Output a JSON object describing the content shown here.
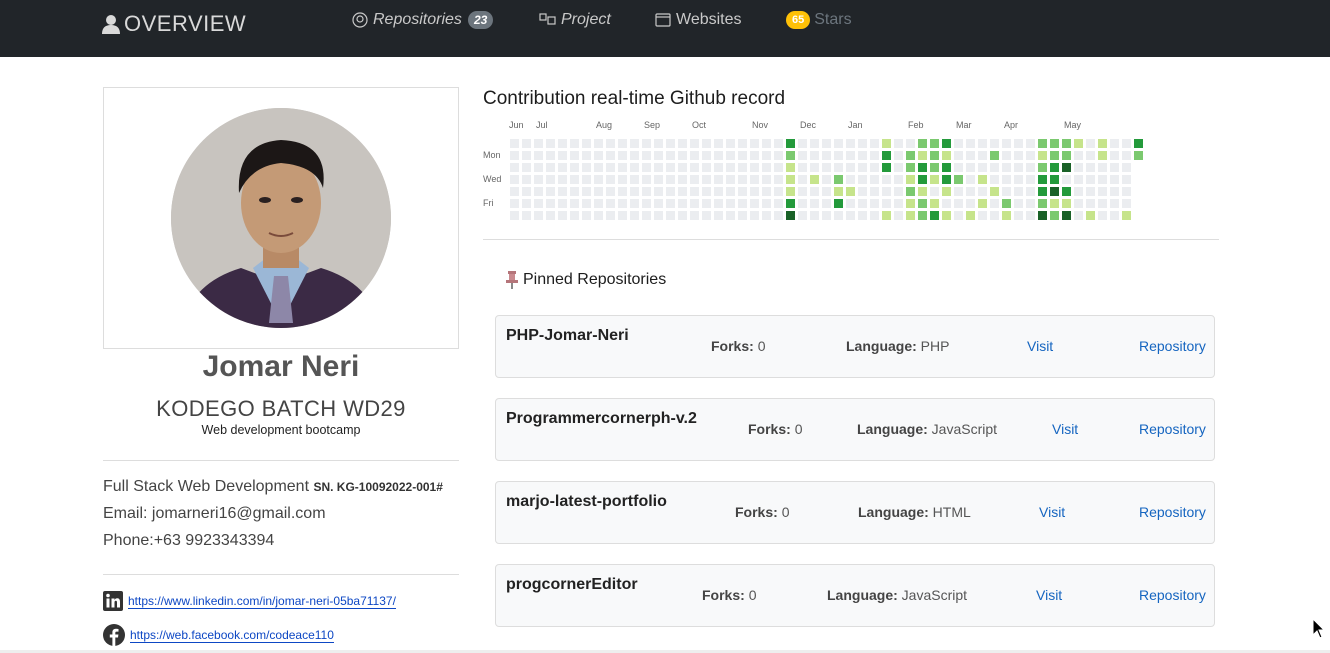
{
  "nav": {
    "brand": "OVERVIEW",
    "repositories_label": "Repositories",
    "repositories_count": "23",
    "project_label": "Project",
    "websites_label": "Websites",
    "stars_count": "65",
    "stars_label": "Stars"
  },
  "profile": {
    "name": "Jomar Neri",
    "batch": "KODEGO BATCH WD29",
    "bootcamp": "Web development bootcamp",
    "role": "Full Stack Web Development",
    "serial": "SN. KG-10092022-001#",
    "email": "Email: jomarneri16@gmail.com",
    "phone": "Phone:+63 9923343394",
    "linkedin": "https://www.linkedin.com/in/jomar-neri-05ba71137/",
    "facebook": "https://web.facebook.com/codeace110"
  },
  "contrib": {
    "title": "Contribution real-time Github record",
    "months": [
      "Jun",
      "Jul",
      "Aug",
      "Sep",
      "Oct",
      "Nov",
      "Dec",
      "Jan",
      "Feb",
      "Mar",
      "Apr",
      "May"
    ],
    "days": [
      "Mon",
      "Wed",
      "Fri"
    ],
    "colors": [
      "#ebedf0",
      "#c6e48b",
      "#7bc96f",
      "#239a3b",
      "#196127"
    ]
  },
  "pinned": {
    "title": "Pinned Repositories",
    "forks_label": "Forks:",
    "language_label": "Language:",
    "visit_label": "Visit",
    "repo_label": "Repository",
    "repos": [
      {
        "name": "PHP-Jomar-Neri",
        "forks": "0",
        "language": "PHP"
      },
      {
        "name": "Programmercornerph-v.2",
        "forks": "0",
        "language": "JavaScript"
      },
      {
        "name": "marjo-latest-portfolio",
        "forks": "0",
        "language": "HTML"
      },
      {
        "name": "progcornerEditor",
        "forks": "0",
        "language": "JavaScript"
      }
    ]
  }
}
